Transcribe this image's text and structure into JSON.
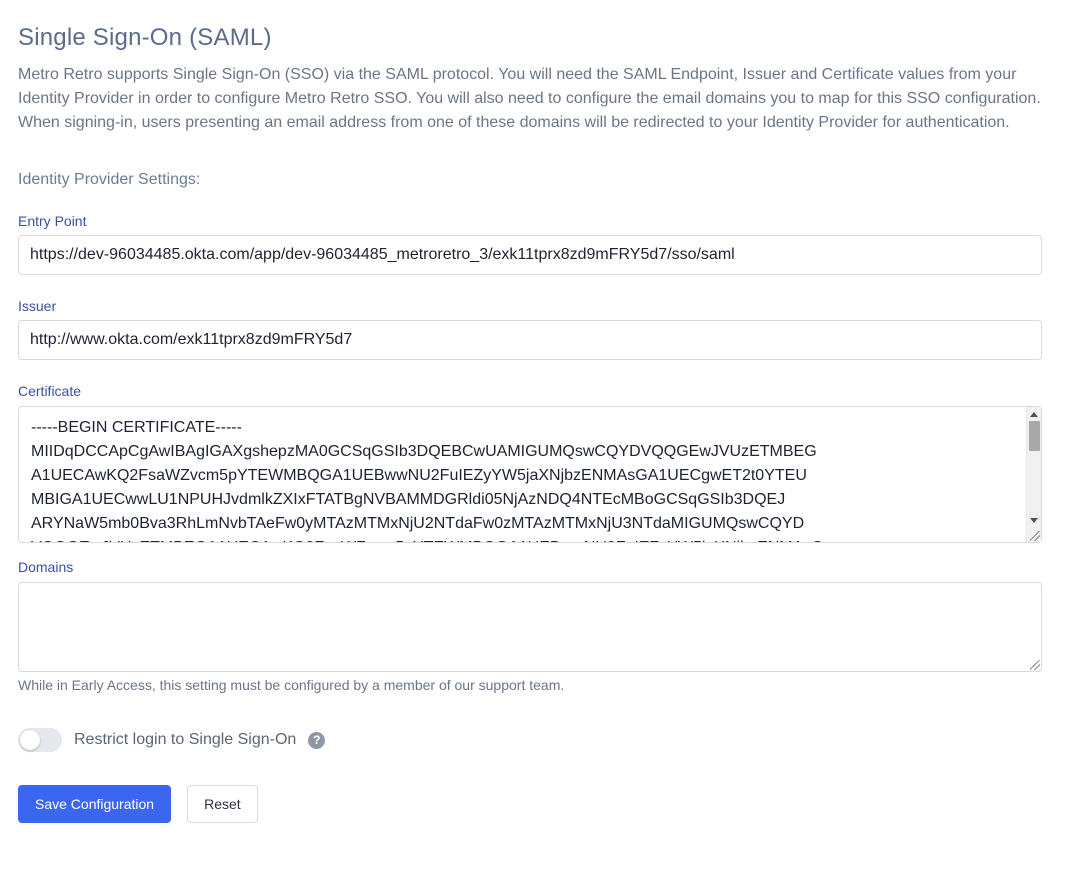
{
  "page": {
    "title": "Single Sign-On (SAML)",
    "description": "Metro Retro supports Single Sign-On (SSO) via the SAML protocol. You will need the SAML Endpoint, Issuer and Certificate values from your Identity Provider in order to configure Metro Retro SSO. You will also need to configure the email domains you to map for this SSO configuration. When signing-in, users presenting an email address from one of these domains will be redirected to your Identity Provider for authentication."
  },
  "idp": {
    "heading": "Identity Provider Settings:",
    "entry_point": {
      "label": "Entry Point",
      "value": "https://dev-96034485.okta.com/app/dev-96034485_metroretro_3/exk11tprx8zd9mFRY5d7/sso/saml"
    },
    "issuer": {
      "label": "Issuer",
      "value": "http://www.okta.com/exk11tprx8zd9mFRY5d7"
    },
    "certificate": {
      "label": "Certificate",
      "value": "-----BEGIN CERTIFICATE-----\nMIIDqDCCApCgAwIBAgIGAXgshepzMA0GCSqGSIb3DQEBCwUAMIGUMQswCQYDVQQGEwJVUzETMBEG\nA1UECAwKQ2FsaWZvcm5pYTEWMBQGA1UEBwwNU2FuIEZyYW5jaXNjbzENMAsGA1UECgwET2t0YTEU\nMBIGA1UECwwLU1NPUHJvdmlkZXIxFTATBgNVBAMMDGRldi05NjAzNDQ4NTEcMBoGCSqGSIb3DQEJ\nARYNaW5mb0Bva3RhLmNvbTAeFw0yMTAzMTMxNjU2NTdaFw0zMTAzMTMxNjU3NTdaMIGUMQswCQYD\nVQQGEwJVUzETMBEGA1UECAwKQ2FsaWZvcm5pYTEWMBQGA1UEBwwNU2FuIEZyYW5jaXNjbzENMAsG"
    }
  },
  "domains": {
    "label": "Domains",
    "value": "",
    "help": "While in Early Access, this setting must be configured by a member of our support team."
  },
  "restrict": {
    "label": "Restrict login to Single Sign-On",
    "enabled": false,
    "help_icon": "question-circle-icon",
    "help_glyph": "?"
  },
  "actions": {
    "save_label": "Save Configuration",
    "reset_label": "Reset"
  },
  "colors": {
    "primary": "#3b66f0",
    "label": "#3a4fa5",
    "title": "#5a6b8c"
  }
}
